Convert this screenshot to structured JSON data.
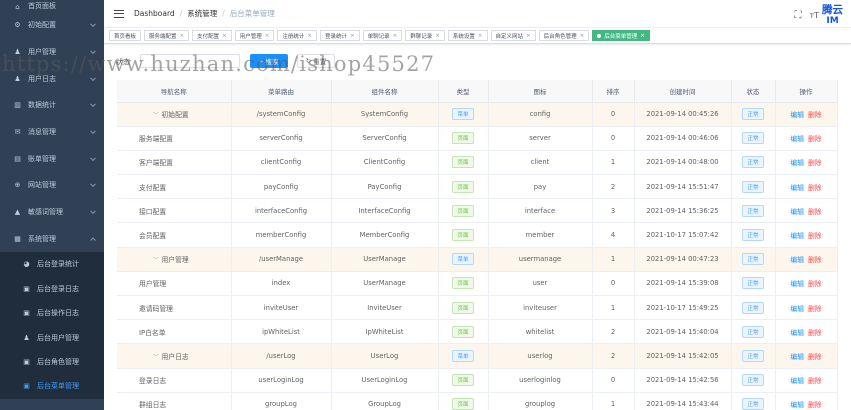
{
  "sidebar": {
    "items": [
      {
        "label": "首页面板",
        "icon": "home-icon",
        "expanded": false
      },
      {
        "label": "初始配置",
        "icon": "gear-icon",
        "expanded": false
      },
      {
        "label": "用户管理",
        "icon": "user-icon",
        "expanded": false
      },
      {
        "label": "用户日志",
        "icon": "user-log-icon",
        "expanded": false
      },
      {
        "label": "数据统计",
        "icon": "chart-icon",
        "expanded": false
      },
      {
        "label": "消息管理",
        "icon": "message-icon",
        "expanded": false
      },
      {
        "label": "账单管理",
        "icon": "bill-icon",
        "expanded": false
      },
      {
        "label": "网站管理",
        "icon": "site-icon",
        "expanded": false
      },
      {
        "label": "敏感词管理",
        "icon": "warning-icon",
        "expanded": false
      },
      {
        "label": "系统管理",
        "icon": "system-icon",
        "expanded": true
      }
    ],
    "subitems": [
      {
        "label": "后台登录统计",
        "icon": "stats-icon",
        "active": false
      },
      {
        "label": "后台登录日志",
        "icon": "log-icon",
        "active": false
      },
      {
        "label": "后台操作日志",
        "icon": "log-icon",
        "active": false
      },
      {
        "label": "后台用户管理",
        "icon": "admin-user-icon",
        "active": false
      },
      {
        "label": "后台角色管理",
        "icon": "role-icon",
        "active": false
      },
      {
        "label": "后台菜单管理",
        "icon": "menu-icon",
        "active": true
      }
    ]
  },
  "header": {
    "breadcrumb": [
      "Dashboard",
      "系统管理",
      "后台菜单管理"
    ],
    "brand_line1": "腾云",
    "brand_line2": "IM"
  },
  "tags": [
    {
      "label": "首页看板",
      "closable": false,
      "active": false
    },
    {
      "label": "服务端配置",
      "closable": true,
      "active": false
    },
    {
      "label": "支付配置",
      "closable": true,
      "active": false
    },
    {
      "label": "用户管理",
      "closable": true,
      "active": false
    },
    {
      "label": "注册统计",
      "closable": true,
      "active": false
    },
    {
      "label": "登录统计",
      "closable": true,
      "active": false
    },
    {
      "label": "单聊记录",
      "closable": true,
      "active": false
    },
    {
      "label": "群聊记录",
      "closable": true,
      "active": false
    },
    {
      "label": "系统设置",
      "closable": true,
      "active": false
    },
    {
      "label": "自定义网站",
      "closable": true,
      "active": false
    },
    {
      "label": "后台角色管理",
      "closable": true,
      "active": false
    },
    {
      "label": "后台菜单管理",
      "closable": true,
      "active": true
    }
  ],
  "filter": {
    "status_label": "状态",
    "status_placeholder": "",
    "search_label": "搜索",
    "reset_label": "重置"
  },
  "watermark": "https://www.huzhan.com/ishop45527",
  "table": {
    "columns": [
      "导航名称",
      "菜单路由",
      "组件名称",
      "类型",
      "图标",
      "排序",
      "创建时间",
      "状态",
      "操作"
    ],
    "edit_label": "编辑",
    "delete_label": "删除",
    "rows": [
      {
        "name": "初始配置",
        "route": "/systemConfig",
        "component": "SystemConfig",
        "type": "菜单",
        "icon": "config",
        "sort": "0",
        "created": "2021-09-14 00:45:26",
        "status": "正常",
        "level": "parent"
      },
      {
        "name": "服务端配置",
        "route": "serverConfig",
        "component": "ServerConfig",
        "type": "页面",
        "icon": "server",
        "sort": "0",
        "created": "2021-09-14 00:46:06",
        "status": "正常",
        "level": "child"
      },
      {
        "name": "客户端配置",
        "route": "clientConfig",
        "component": "ClientConfig",
        "type": "页面",
        "icon": "client",
        "sort": "1",
        "created": "2021-09-14 00:48:00",
        "status": "正常",
        "level": "child"
      },
      {
        "name": "支付配置",
        "route": "payConfig",
        "component": "PayConfig",
        "type": "页面",
        "icon": "pay",
        "sort": "2",
        "created": "2021-09-14 15:51:47",
        "status": "正常",
        "level": "child"
      },
      {
        "name": "接口配置",
        "route": "interfaceConfig",
        "component": "InterfaceConfig",
        "type": "页面",
        "icon": "interface",
        "sort": "3",
        "created": "2021-09-14 15:36:25",
        "status": "正常",
        "level": "child"
      },
      {
        "name": "会员配置",
        "route": "memberConfig",
        "component": "MemberConfig",
        "type": "页面",
        "icon": "member",
        "sort": "4",
        "created": "2021-10-17 15:07:42",
        "status": "正常",
        "level": "child"
      },
      {
        "name": "用户管理",
        "route": "/userManage",
        "component": "UserManage",
        "type": "菜单",
        "icon": "usermanage",
        "sort": "1",
        "created": "2021-09-14 00:47:23",
        "status": "正常",
        "level": "parent"
      },
      {
        "name": "用户管理",
        "route": "index",
        "component": "UserManage",
        "type": "页面",
        "icon": "user",
        "sort": "0",
        "created": "2021-09-14 15:39:08",
        "status": "正常",
        "level": "child"
      },
      {
        "name": "邀请码管理",
        "route": "inviteUser",
        "component": "InviteUser",
        "type": "页面",
        "icon": "inviteuser",
        "sort": "1",
        "created": "2021-10-17 15:49:25",
        "status": "正常",
        "level": "child"
      },
      {
        "name": "IP白名单",
        "route": "ipWhiteList",
        "component": "IpWhiteList",
        "type": "页面",
        "icon": "whitelist",
        "sort": "2",
        "created": "2021-09-14 15:40:04",
        "status": "正常",
        "level": "child"
      },
      {
        "name": "用户日志",
        "route": "/userLog",
        "component": "UserLog",
        "type": "菜单",
        "icon": "userlog",
        "sort": "2",
        "created": "2021-09-14 15:42:05",
        "status": "正常",
        "level": "parent"
      },
      {
        "name": "登录日志",
        "route": "userLoginLog",
        "component": "UserLoginLog",
        "type": "页面",
        "icon": "userloginlog",
        "sort": "0",
        "created": "2021-09-14 15:42:56",
        "status": "正常",
        "level": "child"
      },
      {
        "name": "群组日志",
        "route": "groupLog",
        "component": "GroupLog",
        "type": "页面",
        "icon": "grouplog",
        "sort": "1",
        "created": "2021-09-14 15:43:44",
        "status": "正常",
        "level": "child"
      }
    ]
  }
}
